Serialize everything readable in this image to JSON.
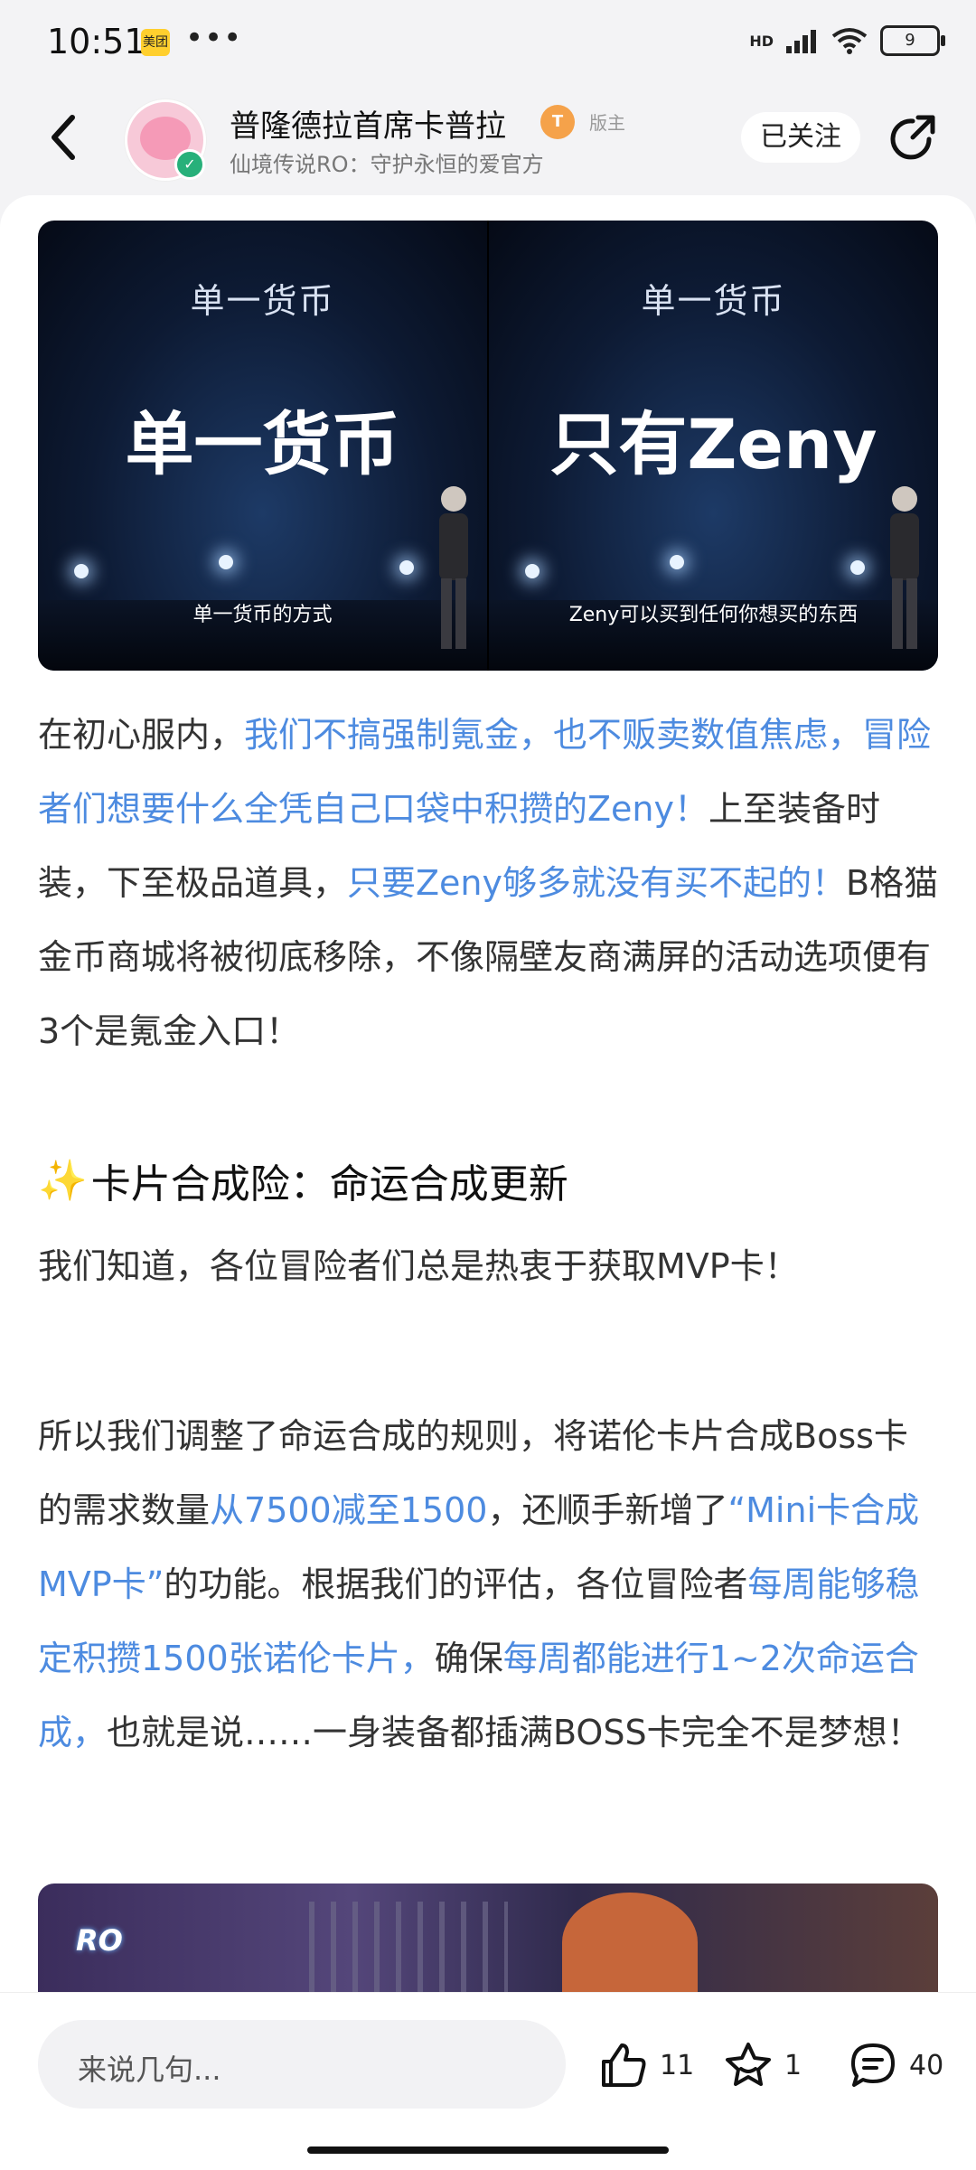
{
  "status_bar": {
    "time": "10:51",
    "app_badge": "美团",
    "more": "•••",
    "hd": "HD",
    "battery": "9"
  },
  "header": {
    "poster_name": "普隆德拉首席卡普拉",
    "level_badge": "T",
    "role": "版主",
    "forum": "仙境传说RO：守护永恒的爱官方",
    "follow_label": "已关注"
  },
  "banner": {
    "left": {
      "small": "单一货币",
      "big": "单一货币",
      "caption": "单一货币的方式"
    },
    "right": {
      "small": "单一货币",
      "big": "只有Zeny",
      "caption": "Zeny可以买到任何你想买的东西"
    }
  },
  "para1": [
    {
      "text": "在初心服内，",
      "hl": false
    },
    {
      "text": "我们不搞强制氪金，也不贩卖数值焦虑，冒险者们想要什么全凭自己口袋中积攒的Zeny！",
      "hl": true
    },
    {
      "text": "上至装备时装，下至极品道具，",
      "hl": false
    },
    {
      "text": "只要Zeny够多就没有买不起的！",
      "hl": true
    },
    {
      "text": "B格猫金币商城将被彻底移除，不像隔壁友商满屏的活动选项便有3个是氪金入口！",
      "hl": false
    }
  ],
  "section_title": "卡片合成险：命运合成更新",
  "para2": "我们知道，各位冒险者们总是热衷于获取MVP卡！",
  "para3": [
    {
      "text": "所以我们调整了命运合成的规则，将诺伦卡片合成Boss卡的需求数量",
      "hl": false
    },
    {
      "text": "从7500减至1500",
      "hl": true
    },
    {
      "text": "，还顺手新增了",
      "hl": false
    },
    {
      "text": "“Mini卡合成MVP卡”",
      "hl": true
    },
    {
      "text": "的功能。根据我们的评估，各位冒险者",
      "hl": false
    },
    {
      "text": "每周能够稳定积攒1500张诺伦卡片，",
      "hl": true
    },
    {
      "text": "确保",
      "hl": false
    },
    {
      "text": "每周都能进行1~2次命运合成，",
      "hl": true
    },
    {
      "text": "也就是说……一身装备都插满BOSS卡完全不是梦想！",
      "hl": false
    }
  ],
  "bottom": {
    "comment_placeholder": "来说几句...",
    "likes": "11",
    "favorites": "1",
    "comments": "40"
  },
  "colors": {
    "highlight": "#4d8be0",
    "accent_badge": "#f5a24a"
  }
}
